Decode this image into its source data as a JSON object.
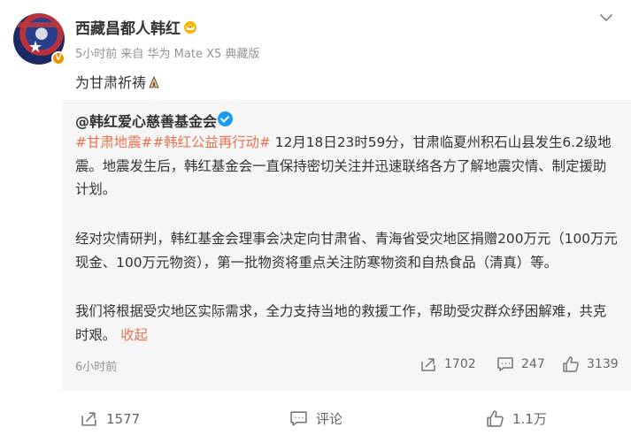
{
  "post": {
    "author": "西藏昌都人韩红",
    "meta": "5小时前 来自 华为 Mate X5 典藏版",
    "text": "为甘肃祈祷"
  },
  "repost": {
    "author": "@韩红爱心慈善基金会",
    "tag1": "#甘肃地震#",
    "tag2": "#韩红公益再行动#",
    "p1_rest": " 12月18日23时59分，甘肃临夏州积石山县发生6.2级地震。地震发生后，韩红基金会一直保持密切关注并迅速联络各方了解地震灾情、制定援助计划。",
    "p2": "经对灾情研判，韩红基金会理事会决定向甘肃省、青海省受灾地区捐赠200万元（100万元现金、100万元物资），第一批物资将重点关注防寒物资和自热食品（清真）等。",
    "p3": "我们将根据受灾地区实际需求，全力支持当地的救援工作，帮助受灾群众纾困解难，共克时艰。",
    "collapse": "收起",
    "time": "6小时前",
    "reposts": "1702",
    "comments": "247",
    "likes": "3139"
  },
  "footer": {
    "reposts": "1577",
    "comments": "评论",
    "likes": "1.1万"
  },
  "colors": {
    "accent": "#eb7350",
    "verified_orange": "#f29100",
    "verified_blue": "#1d9bf0",
    "repost_bg": "#f6f6f6"
  }
}
